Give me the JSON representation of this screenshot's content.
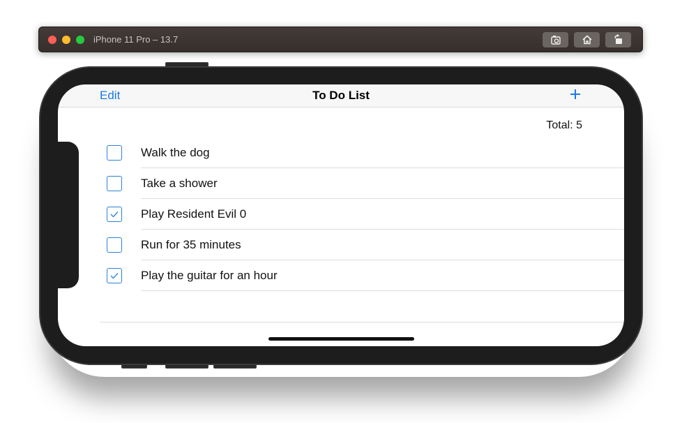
{
  "window": {
    "title": "iPhone 11 Pro – 13.7",
    "toolbar": {
      "screenshot_icon": "camera-icon",
      "home_icon": "home-icon",
      "rotate_icon": "rotate-icon"
    }
  },
  "navbar": {
    "edit_label": "Edit",
    "title": "To Do List",
    "add_icon": "plus-icon"
  },
  "total_label": "Total: 5",
  "tasks": [
    {
      "label": "Walk the dog",
      "checked": false
    },
    {
      "label": "Take a shower",
      "checked": false
    },
    {
      "label": "Play Resident Evil 0",
      "checked": true
    },
    {
      "label": "Run for 35 minutes",
      "checked": false
    },
    {
      "label": "Play the guitar for an hour",
      "checked": true
    }
  ],
  "colors": {
    "accent": "#1a7ae3",
    "checkbox_border": "#2a82d9"
  }
}
